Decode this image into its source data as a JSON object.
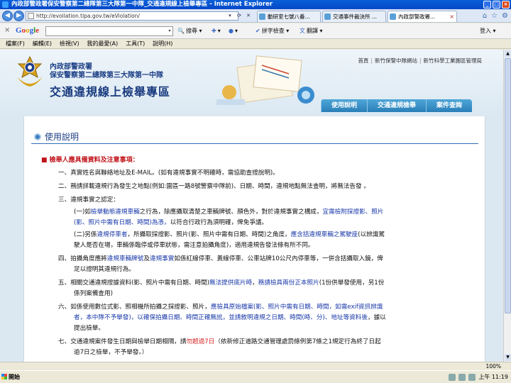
{
  "window": {
    "title": "內政部警政署保安警察第二總隊第三大隊第一中隊_交通違規線上檢舉專區 - Internet Explorer"
  },
  "address": {
    "url": "http://evoilation.tipa.gov.tw/eViolation/"
  },
  "tabs": [
    {
      "label": "動研室七號八番..."
    },
    {
      "label": "交通事件裁決所 ..."
    },
    {
      "label": "內政部警政署..."
    }
  ],
  "google_bar": {
    "logo": "Google",
    "search": "搜尋",
    "spell": "拼字檢查",
    "translate": "翻譯",
    "login": "登入"
  },
  "menu": [
    "檔案(F)",
    "編輯(E)",
    "檢視(V)",
    "我的最愛(A)",
    "工具(T)",
    "說明(H)"
  ],
  "header": {
    "agency_line1": "內政部警政署",
    "agency_line2": "保安警察第二總隊第三大隊第一中隊",
    "system_name": "交通違規線上檢舉專區",
    "top_links": [
      "首頁",
      "新竹保警中隊網站",
      "新竹科學工業園區管理局"
    ],
    "nav_tabs": [
      "使用說明",
      "交通違規檢舉",
      "案件查詢"
    ]
  },
  "content": {
    "section_title": "使用說明",
    "heading": "■ 檢舉人應具備資料及注意事項：",
    "items": {
      "i1": {
        "num": "一、",
        "text": "真實姓名與聯絡地址及E-MAIL。(如有違規事實不明確時，需協助查證說明)。"
      },
      "i2": {
        "num": "二、",
        "text": "務請詳載違規行為發生之地點(例如:園區一路8號警察中隊前)、日期、時間，違規地點無法查明，將無法告發 。"
      },
      "i3": {
        "num": "三、",
        "text": "違規事實之認定："
      },
      "i3a1": {
        "a": "(一)如",
        "b": "檢舉動態違規車輛",
        "c": "之行為，除應攝取清楚之車輛牌號、顏色外，對於違規事實之構成，",
        "d": "宜需檢附採證影、照片"
      },
      "i3a2": {
        "a": "(影、照片中需有日期、時間)為憑，",
        "b": "以符合行政行為須明確，俾免爭議。"
      },
      "i3b1": {
        "a": "(二)另係",
        "b": "違規停車者",
        "c": "，所攝取採證影、照片(影、照片中需有日期、時間)之角度，",
        "d": "應含括違規車輛之駕駛座",
        "e": "(以辨識駕"
      },
      "i3b2": {
        "a": "駛人是否在場，車輛係臨停或停車狀態，需注意拍攝角度)，適用違規告發法條有所不同。"
      },
      "i4a": {
        "num": "四、",
        "a": "拍攝角度應將",
        "b": "違規車輛牌號",
        "c": "及",
        "d": "違規事實",
        "e": "如係紅線停車、黃線停車、公車站牌10公尺內停車等，一併含括攝取入鏡，俾"
      },
      "i4b": {
        "a": "足以證明其違規行為。"
      },
      "i5a": {
        "num": "五、",
        "a": "相關交通違規證據資料(影、照片中需有日期、時間)",
        "b": "無法提供底片時",
        "c": "，",
        "d": "務請檢具兩份正本照片",
        "e": "(1份供舉發使用，另1份"
      },
      "i5b": {
        "a": "係列案備查用)"
      },
      "i6a": {
        "num": "六、",
        "a": "如係使用數位式影、照相機所拍攝之採證影、照片，",
        "b": "應檢具原始檔案(影、照片中需有日期、時間，如需exif資訊辨識"
      },
      "i6b": {
        "a": "者，本中隊不予舉發)，以確保拍攝日期、時間正確無訛，並請敘明違規之日期、時間(時、分)、地址等資料後",
        "b": "，據以"
      },
      "i6c": {
        "a": "提出檢舉。"
      },
      "i7a": {
        "num": "七、",
        "a": "交通違規案件發生日期與檢舉日期相隔，請",
        "b": "勿超過7日",
        "c": "（依新修正道路交通管理處罰條例第7條之1規定行為終了日起"
      },
      "i7b": {
        "a": "逾7日之檢舉，不予舉發。）"
      }
    }
  },
  "status": {
    "zoom": "100%"
  },
  "taskbar": {
    "start": "開始",
    "clock": "上午 11:19"
  },
  "colors": {
    "accent": "#2a7fb8",
    "heading_red": "#c0141a",
    "link_blue": "#1737a8"
  }
}
